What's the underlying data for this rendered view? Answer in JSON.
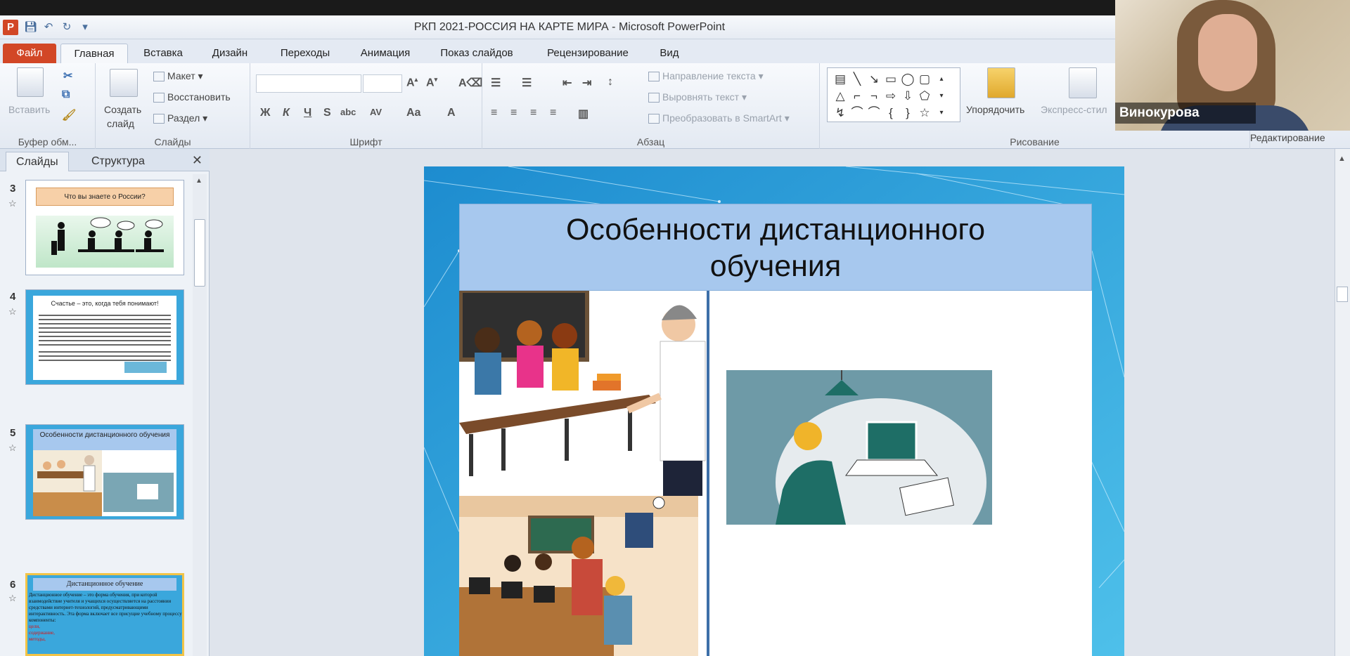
{
  "window": {
    "title": "РКП 2021-РОССИЯ НА КАРТЕ МИРА  -  Microsoft PowerPoint"
  },
  "app_icon": "P",
  "tabs": [
    "Файл",
    "Главная",
    "Вставка",
    "Дизайн",
    "Переходы",
    "Анимация",
    "Показ слайдов",
    "Рецензирование",
    "Вид"
  ],
  "active_tab": "Главная",
  "ribbon": {
    "clipboard": {
      "paste": "Вставить",
      "label": "Буфер обм..."
    },
    "slides": {
      "create": "Создать",
      "create2": "слайд",
      "layout": "Макет",
      "reset": "Восстановить",
      "section": "Раздел",
      "label": "Слайды"
    },
    "font": {
      "bold": "Ж",
      "italic": "К",
      "underline": "Ч",
      "strike": "S",
      "shadow": "abc",
      "spacing": "AV",
      "case": "Aa",
      "color": "A",
      "label": "Шрифт"
    },
    "paragraph": {
      "direction": "Направление текста",
      "align": "Выровнять текст",
      "smartart": "Преобразовать в SmartArt",
      "label": "Абзац"
    },
    "drawing": {
      "arrange": "Упорядочить",
      "styles": "Экспресс-стил",
      "label": "Рисование"
    },
    "editing": {
      "label": "Редактирование"
    }
  },
  "webcam": {
    "name": "Винокурова"
  },
  "panel": {
    "tab_slides": "Слайды",
    "tab_outline": "Структура",
    "close": "✕"
  },
  "thumbnails": [
    {
      "num": "3",
      "title": "Что вы знаете о России?"
    },
    {
      "num": "4",
      "title": "Счастье – это, когда тебя понимают!"
    },
    {
      "num": "5",
      "title": "Особенности  дистанционного обучения"
    },
    {
      "num": "6",
      "title": "Дистанционное обучение",
      "text": "Дистанционное обучение – это форма обучения, при которой взаимодействие учителя и учащихся осуществляется на расстоянии средствами интернет-технологий, предусматривающими интерактивность. Эта форма включает все присущие учебному процессу компоненты:",
      "red": "цели,\nсодержание,\nметоды,"
    }
  ],
  "slide": {
    "title_line1": "Особенности  дистанционного",
    "title_line2": "обучения"
  },
  "colors": {
    "file_tab": "#d24726",
    "slide_bg": "#29a3d8",
    "title_box": "#a7c8ee",
    "selected_thumb": "#f2c447"
  }
}
